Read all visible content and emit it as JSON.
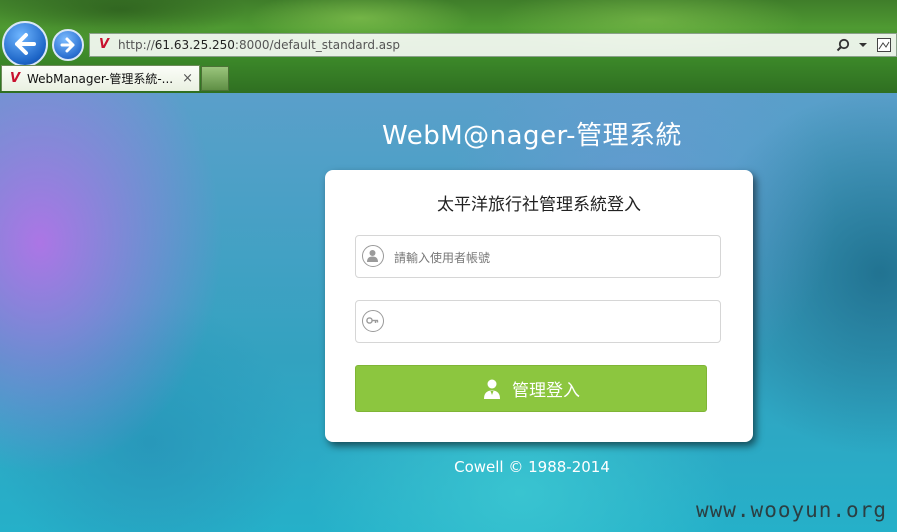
{
  "browser": {
    "url_prefix": "http://",
    "url_host": "61.63.25.250",
    "url_rest": ":8000/default_standard.asp",
    "search_icon": "search-icon",
    "tab_title": "WebManager-管理系統-...",
    "tab_close": "×",
    "back_glyph": "🡐",
    "forward_glyph": "🡒",
    "favicon": "V"
  },
  "page": {
    "site_title": "WebM@nager-管理系統",
    "login_title": "太平洋旅行社管理系統登入",
    "username_placeholder": "請輸入使用者帳號",
    "password_placeholder": "",
    "login_button_label": "管理登入",
    "copyright": "Cowell © 1988-2014"
  },
  "watermark": "www.wooyun.org",
  "colors": {
    "button_green": "#8cc63f",
    "card_bg": "#ffffff",
    "title_text": "#ffffff"
  }
}
